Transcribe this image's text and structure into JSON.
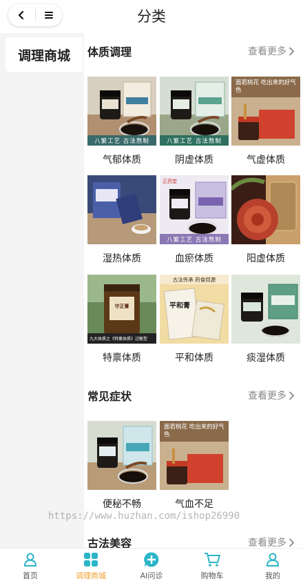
{
  "header": {
    "title": "分类"
  },
  "sidebar": {
    "items": [
      {
        "label": "调理商城",
        "active": true
      }
    ]
  },
  "sections": [
    {
      "title": "体质调理",
      "more": "查看更多",
      "items": [
        {
          "label": "气郁体质",
          "caption": "八繁工艺 古法熬制"
        },
        {
          "label": "阴虚体质",
          "caption": "八繁工艺 古法熬制"
        },
        {
          "label": "气虚体质",
          "caption": "面若桃花 吃出来的好气色"
        },
        {
          "label": "湿热体质"
        },
        {
          "label": "血瘀体质",
          "caption": "八繁工艺 古法熬制",
          "brand": "正药堂"
        },
        {
          "label": "阳虚体质"
        },
        {
          "label": "特禀体质",
          "caption": "九大体质之《特禀体质》过敏型",
          "jar_text": "守正膏"
        },
        {
          "label": "平和体质",
          "banner": "古法传承 药食同源",
          "jar_text": "平和膏"
        },
        {
          "label": "痰湿体质"
        }
      ]
    },
    {
      "title": "常见症状",
      "more": "查看更多",
      "items": [
        {
          "label": "便秘不畅"
        },
        {
          "label": "气血不足",
          "caption": "面若桃花 吃出来的好气色"
        }
      ]
    },
    {
      "title": "古法美容",
      "more": "查看更多",
      "items": []
    }
  ],
  "watermark": "https://www.huzhan.com/ishop26990",
  "tabbar": [
    {
      "label": "首页",
      "icon": "person-icon",
      "active": false
    },
    {
      "label": "调理商城",
      "icon": "grid-icon",
      "active": true
    },
    {
      "label": "AI问诊",
      "icon": "chat-plus-icon",
      "active": false
    },
    {
      "label": "购物车",
      "icon": "cart-icon",
      "active": false
    },
    {
      "label": "我的",
      "icon": "user-icon",
      "active": false
    }
  ],
  "colors": {
    "accent": "#2bb5c8",
    "active_label": "#f0a030",
    "sidebar_bg": "#f4f4f4"
  }
}
